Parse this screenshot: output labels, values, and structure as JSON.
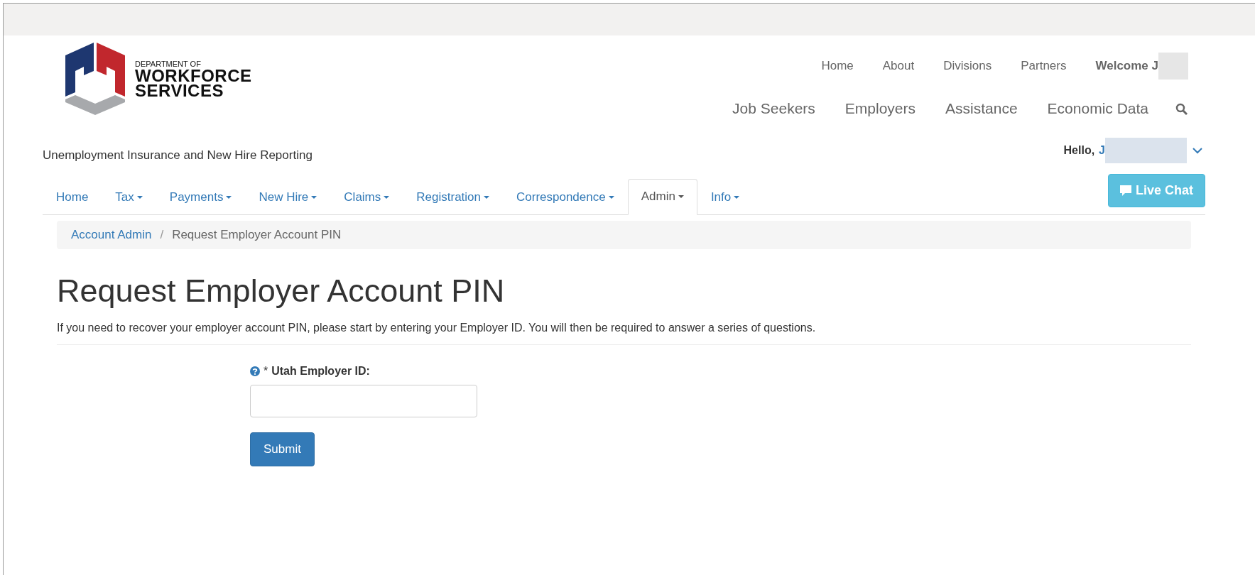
{
  "logo": {
    "line_1": "DEPARTMENT OF",
    "line_2": "WORKFORCE",
    "line_3": "SERVICES"
  },
  "top_links": [
    "Home",
    "About",
    "Divisions",
    "Partners"
  ],
  "welcome": {
    "text": "Welcome J",
    "redacted": true
  },
  "main_nav": [
    "Job Seekers",
    "Employers",
    "Assistance",
    "Economic Data"
  ],
  "subtitle": "Unemployment Insurance and New Hire Reporting",
  "user": {
    "greeting": "Hello,",
    "name": "J",
    "redacted": true
  },
  "tabs": [
    {
      "label": "Home",
      "dropdown": false,
      "selected": false
    },
    {
      "label": "Tax",
      "dropdown": true,
      "selected": false
    },
    {
      "label": "Payments",
      "dropdown": true,
      "selected": false
    },
    {
      "label": "New Hire",
      "dropdown": true,
      "selected": false
    },
    {
      "label": "Claims",
      "dropdown": true,
      "selected": false
    },
    {
      "label": "Registration",
      "dropdown": true,
      "selected": false
    },
    {
      "label": "Correspondence",
      "dropdown": true,
      "selected": false
    },
    {
      "label": "Admin",
      "dropdown": true,
      "selected": true
    },
    {
      "label": "Info",
      "dropdown": true,
      "selected": false
    }
  ],
  "live_chat": "Live Chat",
  "breadcrumb": [
    "Account Admin",
    "Request Employer Account PIN"
  ],
  "breadcrumb_separator": "/",
  "title": "Request Employer Account PIN",
  "intro": "If you need to recover your employer account PIN, please start by entering your Employer ID. You will then be required to answer a series of questions.",
  "form": {
    "required_mark": "*",
    "label": "Utah Employer ID:",
    "submit": "Submit"
  }
}
